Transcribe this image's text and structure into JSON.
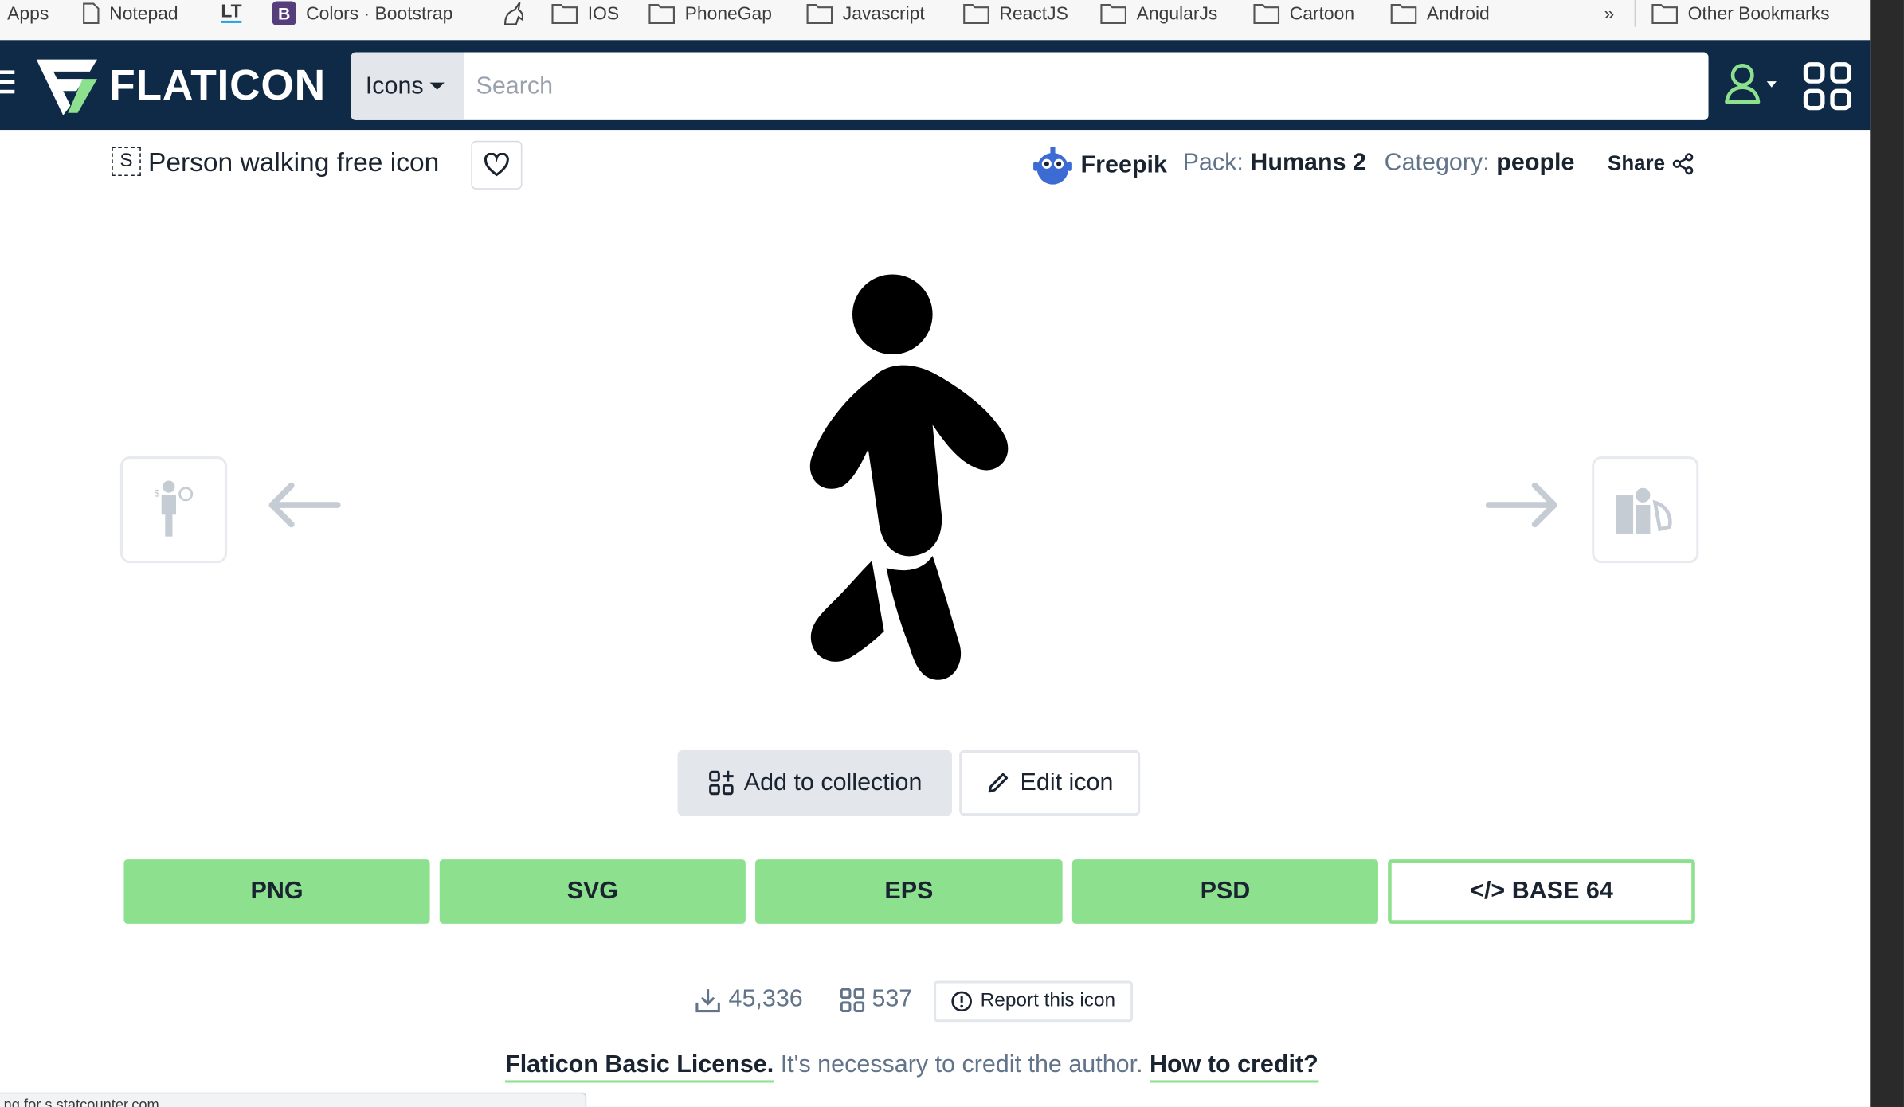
{
  "bookmarks": {
    "items": [
      {
        "label": "Apps",
        "icon": "apps-icon"
      },
      {
        "label": "Notepad",
        "icon": "page-icon"
      },
      {
        "label": "",
        "icon": "lt-logo-icon"
      },
      {
        "label": "Colors · Bootstrap",
        "icon": "bootstrap-icon"
      },
      {
        "label": "",
        "icon": "unicorn-icon"
      },
      {
        "label": "IOS",
        "icon": "folder-icon"
      },
      {
        "label": "PhoneGap",
        "icon": "folder-icon"
      },
      {
        "label": "Javascript",
        "icon": "folder-icon"
      },
      {
        "label": "ReactJS",
        "icon": "folder-icon"
      },
      {
        "label": "AngularJs",
        "icon": "folder-icon"
      },
      {
        "label": "Cartoon",
        "icon": "folder-icon"
      },
      {
        "label": "Android",
        "icon": "folder-icon"
      }
    ],
    "overflow": "»",
    "other": "Other Bookmarks",
    "lt_text": "LT",
    "bootstrap_letter": "B"
  },
  "header": {
    "logo_text": "FLATICON",
    "search_type": "Icons",
    "search_placeholder": "Search",
    "accent": "#8de08e",
    "bg": "#0e2a47"
  },
  "icon": {
    "badge": "S",
    "title": "Person walking free icon",
    "author": "Freepik",
    "pack_label": "Pack:",
    "pack": "Humans 2",
    "category_label": "Category:",
    "category": "people",
    "share": "Share"
  },
  "actions": {
    "add_to_collection": "Add to collection",
    "edit_icon": "Edit icon"
  },
  "downloads": {
    "png": "PNG",
    "svg": "SVG",
    "eps": "EPS",
    "psd": "PSD",
    "base64": "</> BASE 64"
  },
  "stats": {
    "downloads": "45,336",
    "collections": "537",
    "report": "Report this icon"
  },
  "license": {
    "name": "Flaticon Basic License.",
    "text": " It's necessary to credit the author. ",
    "link": "How to credit?"
  },
  "status_bar": {
    "text": "...ng for s.statcounter.com..."
  }
}
